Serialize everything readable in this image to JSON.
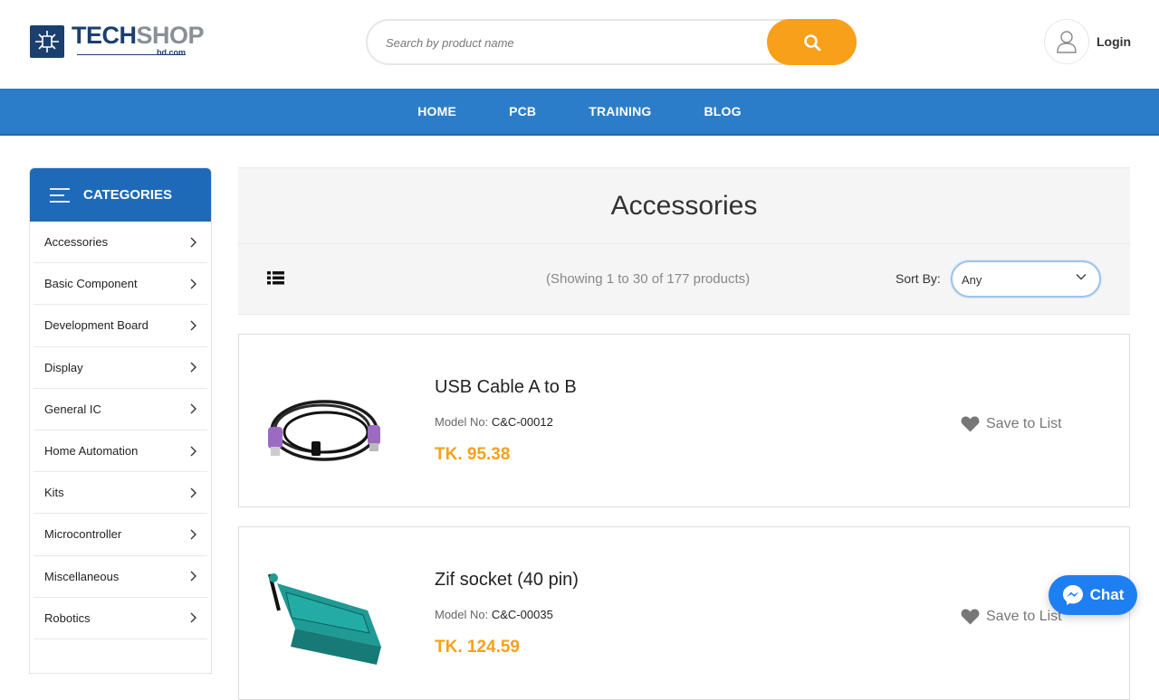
{
  "brand": {
    "name_part1": "TECH",
    "name_part2": "SHOP",
    "domain": "bd.com"
  },
  "search": {
    "placeholder": "Search by product name"
  },
  "account": {
    "login_label": "Login"
  },
  "nav": {
    "items": [
      "HOME",
      "PCB",
      "TRAINING",
      "BLOG"
    ]
  },
  "sidebar": {
    "title": "CATEGORIES",
    "items": [
      "Accessories",
      "Basic Component",
      "Development Board",
      "Display",
      "General IC",
      "Home Automation",
      "Kits",
      "Microcontroller",
      "Miscellaneous",
      "Robotics"
    ]
  },
  "page": {
    "title": "Accessories",
    "showing": "(Showing 1 to 30 of 177 products)",
    "sort_label": "Sort By:",
    "sort_value": "Any"
  },
  "products": [
    {
      "name": "USB Cable A to B",
      "model_label": "Model No:",
      "model": "C&C-00012",
      "price": "TK. 95.38",
      "save_label": "Save to List"
    },
    {
      "name": "Zif socket (40 pin)",
      "model_label": "Model No:",
      "model": "C&C-00035",
      "price": "TK. 124.59",
      "save_label": "Save to List"
    }
  ],
  "chat": {
    "label": "Chat"
  },
  "colors": {
    "nav_blue": "#2b7dc9",
    "category_blue": "#1f6ab8",
    "accent_orange": "#f8a01a",
    "chat_blue": "#1e7ff2"
  },
  "icons": [
    "menu-icon",
    "search-icon",
    "user-icon",
    "chevron-right-icon",
    "list-view-icon",
    "chevron-down-icon",
    "heart-icon",
    "messenger-icon"
  ]
}
